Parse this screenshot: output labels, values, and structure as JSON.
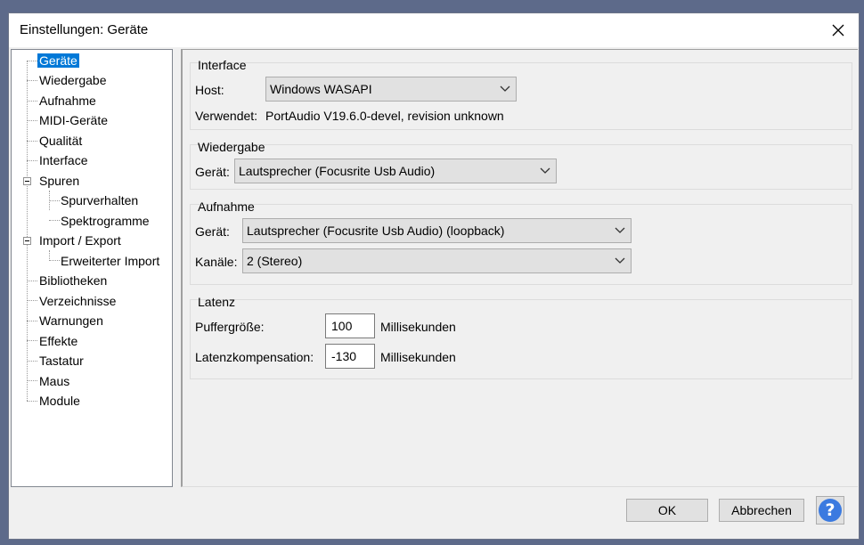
{
  "window": {
    "title": "Einstellungen: Geräte"
  },
  "tree": {
    "items": [
      {
        "label": "Geräte",
        "selected": true
      },
      {
        "label": "Wiedergabe"
      },
      {
        "label": "Aufnahme"
      },
      {
        "label": "MIDI-Geräte"
      },
      {
        "label": "Qualität"
      },
      {
        "label": "Interface"
      },
      {
        "label": "Spuren",
        "expanded": true
      },
      {
        "label": "Spurverhalten"
      },
      {
        "label": "Spektrogramme"
      },
      {
        "label": "Import / Export",
        "expanded": true
      },
      {
        "label": "Erweiterter Import"
      },
      {
        "label": "Bibliotheken"
      },
      {
        "label": "Verzeichnisse"
      },
      {
        "label": "Warnungen"
      },
      {
        "label": "Effekte"
      },
      {
        "label": "Tastatur"
      },
      {
        "label": "Maus"
      },
      {
        "label": "Module"
      }
    ]
  },
  "interface": {
    "title": "Interface",
    "host_label": "Host:",
    "host_value": "Windows WASAPI",
    "used_label": "Verwendet:",
    "used_value": "PortAudio V19.6.0-devel, revision unknown"
  },
  "playback": {
    "title": "Wiedergabe",
    "device_label": "Gerät:",
    "device_value": "Lautsprecher (Focusrite Usb Audio)"
  },
  "recording": {
    "title": "Aufnahme",
    "device_label": "Gerät:",
    "device_value": "Lautsprecher (Focusrite Usb Audio) (loopback)",
    "channels_label": "Kanäle:",
    "channels_value": "2 (Stereo)"
  },
  "latency": {
    "title": "Latenz",
    "buffer_label": "Puffergröße:",
    "buffer_value": "100",
    "buffer_unit": "Millisekunden",
    "comp_label": "Latenzkompensation:",
    "comp_value": "-130",
    "comp_unit": "Millisekunden"
  },
  "buttons": {
    "ok": "OK",
    "cancel": "Abbrechen",
    "help": "?"
  },
  "colors": {
    "selection": "#0078d7",
    "help": "#3b7ae0"
  }
}
